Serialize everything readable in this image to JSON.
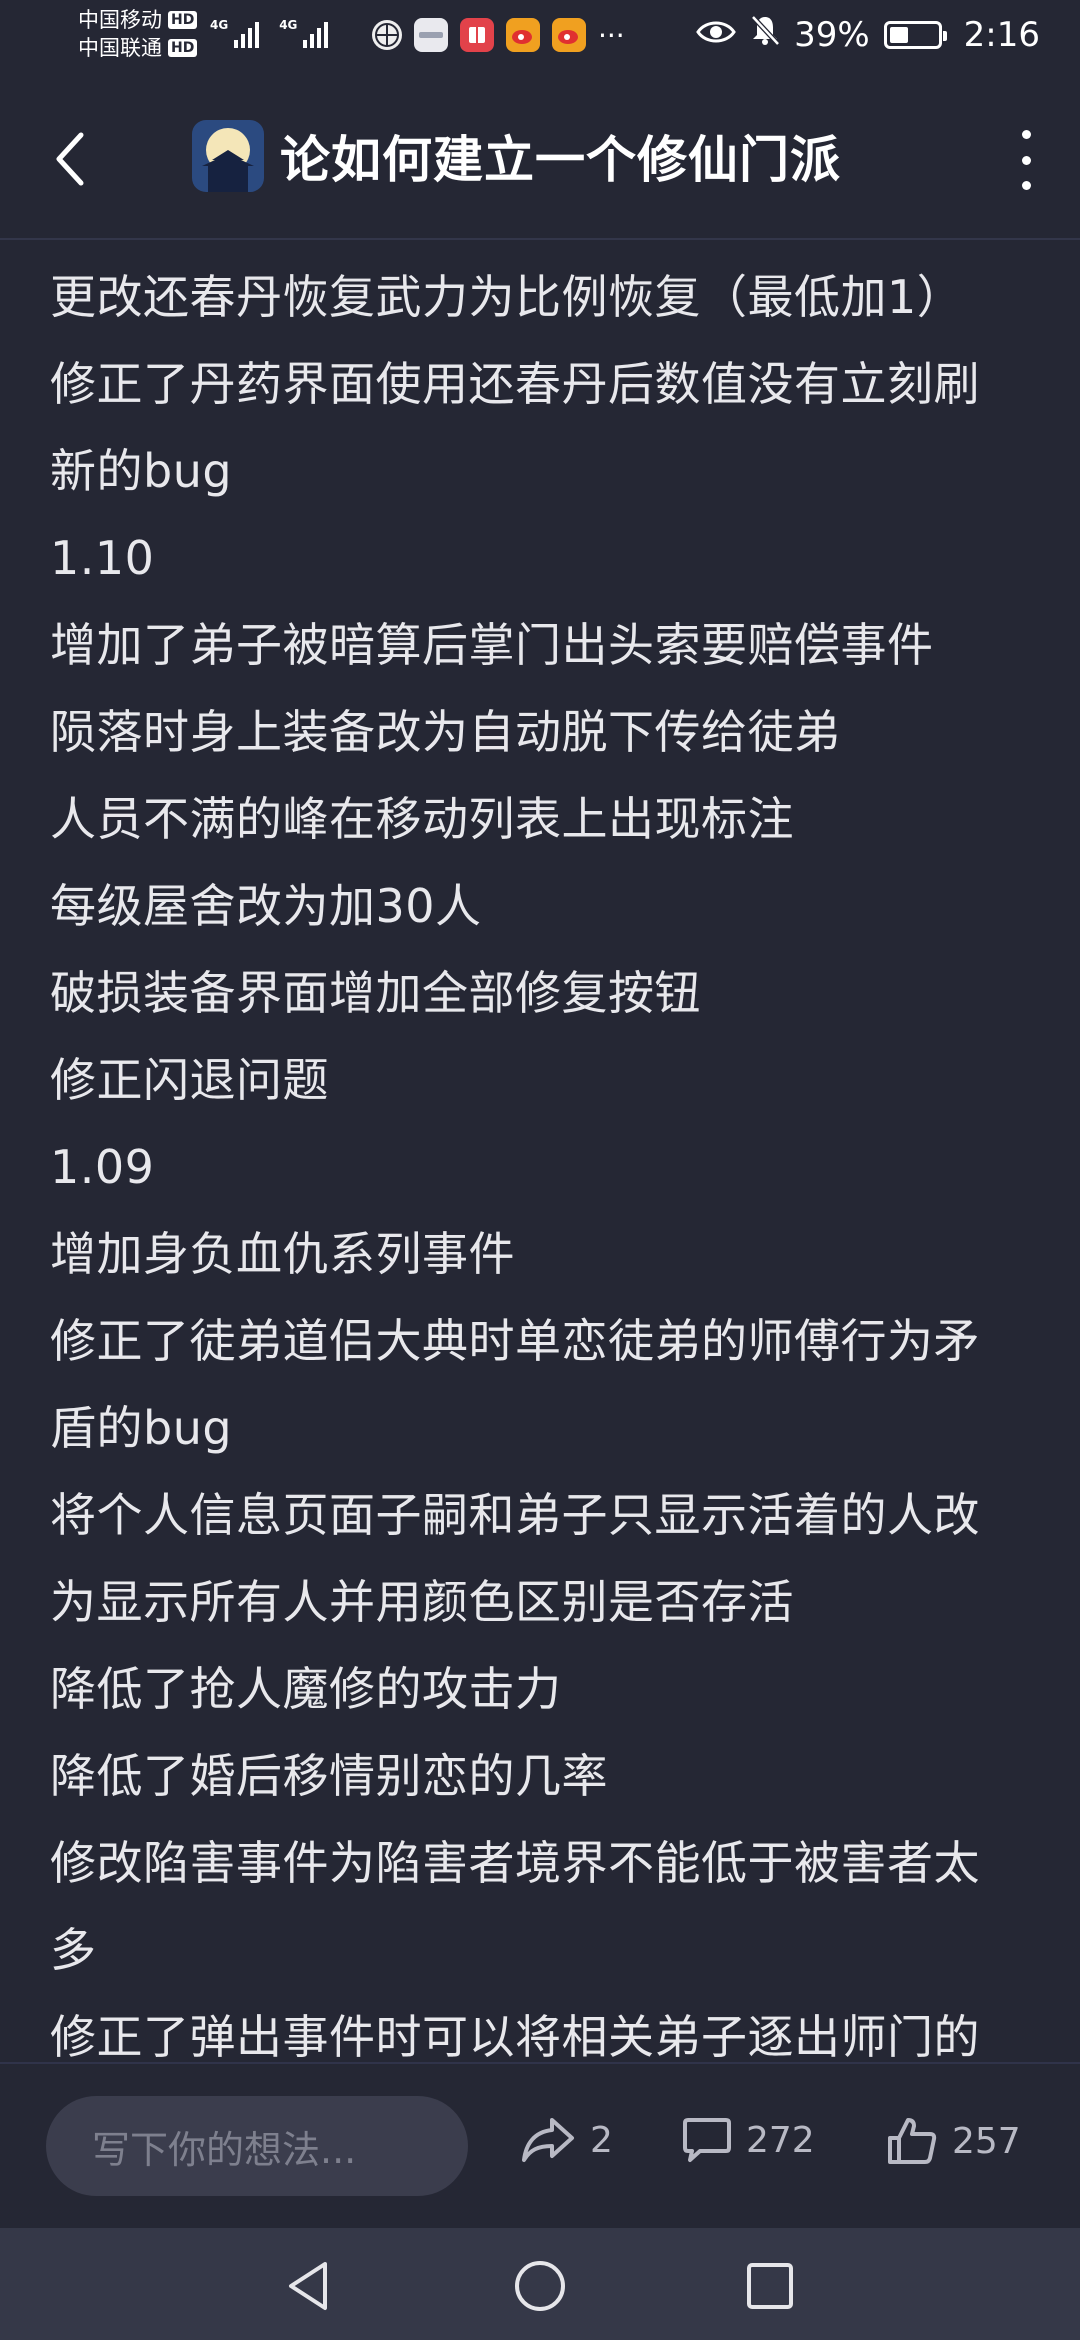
{
  "status_bar": {
    "carrier_1": "中国移动",
    "carrier_2": "中国联通",
    "hd_label": "HD",
    "network_1": "4G",
    "network_2": "4G",
    "more_notifications": "···",
    "battery_percent": "39%",
    "battery_level": 0.39,
    "time": "2:16"
  },
  "header": {
    "title": "论如何建立一个修仙门派"
  },
  "content": {
    "lines": [
      "更改还春丹恢复武力为比例恢复（最低加1）",
      "修正了丹药界面使用还春丹后数值没有立刻刷",
      "新的bug",
      "1.10",
      "增加了弟子被暗算后掌门出头索要赔偿事件",
      "陨落时身上装备改为自动脱下传给徒弟",
      "人员不满的峰在移动列表上出现标注",
      "每级屋舍改为加30人",
      "破损装备界面增加全部修复按钮",
      "修正闪退问题",
      "1.09",
      "增加身负血仇系列事件",
      "修正了徒弟道侣大典时单恋徒弟的师傅行为矛",
      "盾的bug",
      "将个人信息页面子嗣和弟子只显示活着的人改",
      "为显示所有人并用颜色区别是否存活",
      "降低了抢人魔修的攻击力",
      "降低了婚后移情别恋的几率",
      "修改陷害事件为陷害者境界不能低于被害者太",
      "多",
      "修正了弹出事件时可以将相关弟子逐出师门的"
    ]
  },
  "action_bar": {
    "input_placeholder": "写下你的想法...",
    "share_count": "2",
    "comment_count": "272",
    "like_count": "257"
  },
  "colors": {
    "background": "#252734",
    "input_bg": "#3b3d4d",
    "navbar_bg": "#353848",
    "text": "#e8e8ec",
    "muted": "#b8b9c4"
  }
}
